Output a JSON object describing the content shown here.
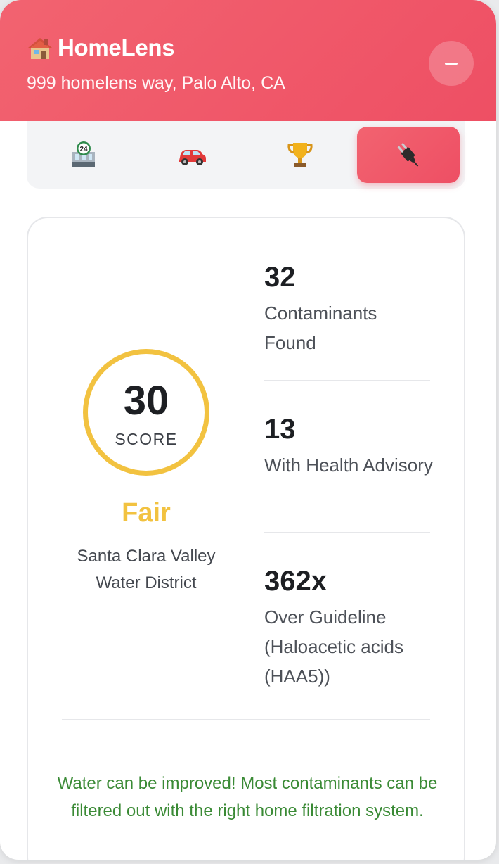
{
  "header": {
    "brand_name": "HomeLens",
    "brand_icon": "house-icon",
    "address": "999 homelens way, Palo Alto, CA",
    "minimize_icon": "minus-icon"
  },
  "tabs": [
    {
      "icon": "open-24-hours-icon",
      "active": false
    },
    {
      "icon": "car-icon",
      "active": false
    },
    {
      "icon": "trophy-icon",
      "active": false
    },
    {
      "icon": "electric-plug-icon",
      "active": true
    }
  ],
  "score": {
    "value": "30",
    "label": "SCORE",
    "rating": "Fair",
    "utility": "Santa Clara Valley Water District"
  },
  "stats": [
    {
      "value": "32",
      "label": "Contaminants Found"
    },
    {
      "value": "13",
      "label": "With Health Advisory"
    },
    {
      "value": "362x",
      "label": "Over Guideline (Haloacetic acids (HAA5))"
    }
  ],
  "message": "Water can be improved! Most contaminants can be filtered out with the right home filtration system.",
  "colors": {
    "accent": "#ee4f64",
    "rating": "#f2c240",
    "message": "#3a8a35"
  }
}
